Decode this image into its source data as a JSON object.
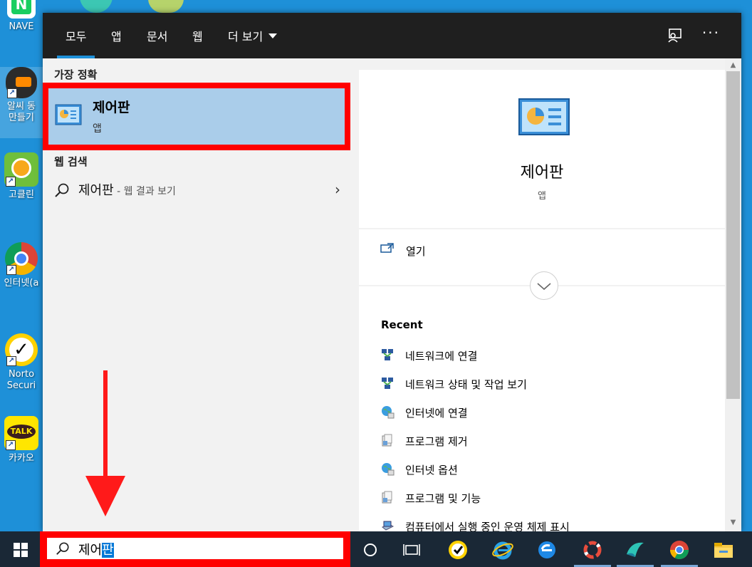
{
  "desktop": {
    "icons": [
      {
        "label": "NAVE"
      },
      {
        "label": "알씨 동"
      },
      {
        "label": "만들기"
      },
      {
        "label": "고클린"
      },
      {
        "label": "인터넷(a"
      },
      {
        "label": "Norto"
      },
      {
        "label": "Securi"
      },
      {
        "label": "카카오"
      }
    ]
  },
  "topbar": {
    "tabs": [
      "모두",
      "앱",
      "문서",
      "웹",
      "더 보기"
    ],
    "more_label": "···"
  },
  "best_match": {
    "heading": "가장 정확",
    "title": "제어판",
    "subtitle": "앱"
  },
  "web_search": {
    "heading": "웹 검색",
    "query": "제어판",
    "hint": " - 웹 결과 보기"
  },
  "preview": {
    "title": "제어판",
    "subtitle": "앱",
    "open_label": "열기",
    "recent_heading": "Recent",
    "recent": [
      "네트워크에 연결",
      "네트워크 상태 및 작업 보기",
      "인터넷에 연결",
      "프로그램 제거",
      "인터넷 옵션",
      "프로그램 및 기능",
      "컴퓨터에서 실행 중인 운영 체제 표시"
    ]
  },
  "taskbar": {
    "search_text_plain": "제어",
    "search_text_selected": "판"
  },
  "colors": {
    "accent": "#1e90d8",
    "highlight": "#ff0000",
    "selected_bg": "#aacdea",
    "taskbar_bg": "#1a2836"
  }
}
